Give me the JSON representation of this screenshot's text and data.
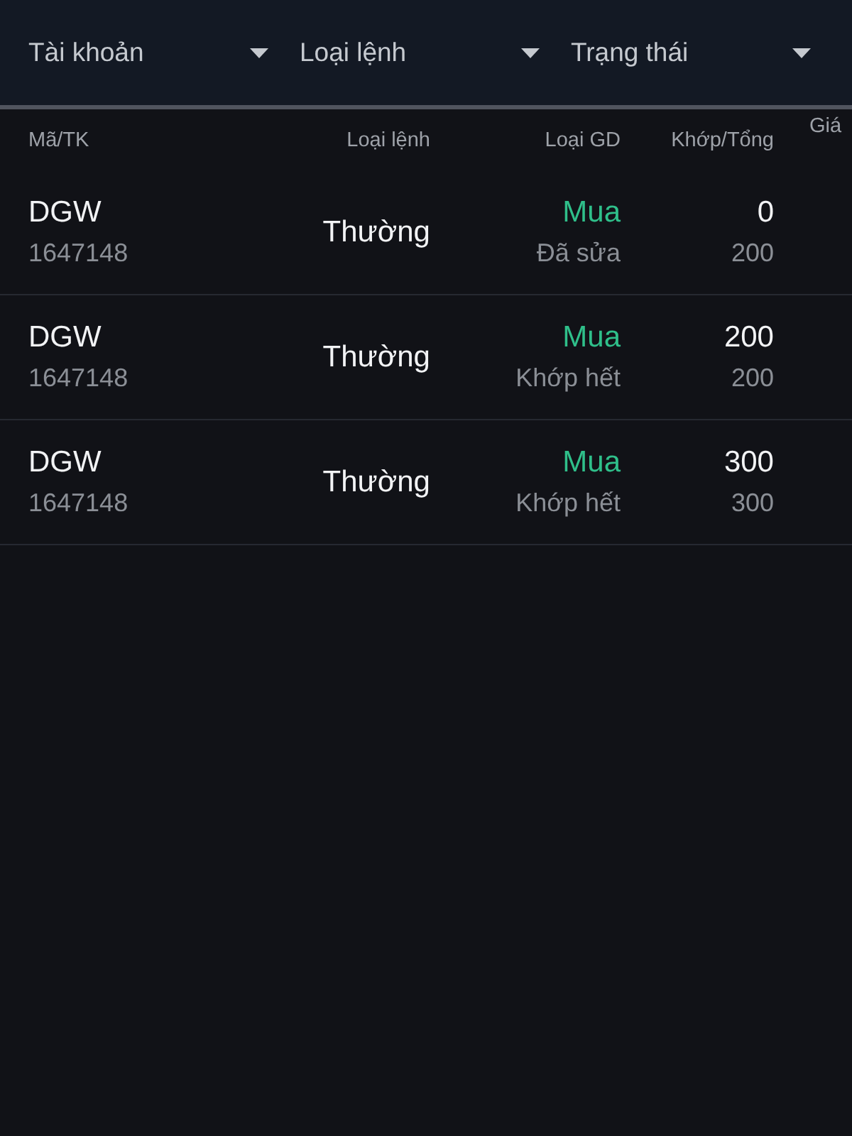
{
  "filters": [
    {
      "label": "Tài khoản"
    },
    {
      "label": "Loại lệnh"
    },
    {
      "label": "Trạng thái"
    }
  ],
  "table": {
    "columns": [
      "Mã/TK",
      "Loại lệnh",
      "Loại GD",
      "Khớp/Tổng",
      "Giá"
    ],
    "rows": [
      {
        "symbol": "DGW",
        "account": "1647148",
        "order_type": "Thường",
        "side": {
          "kind": "buy",
          "label": "Mua"
        },
        "status": "Đã sửa",
        "matched": "0",
        "total": "200"
      },
      {
        "symbol": "DGW",
        "account": "1647148",
        "order_type": "Thường",
        "side": {
          "kind": "buy",
          "label": "Mua"
        },
        "status": "Khớp hết",
        "matched": "200",
        "total": "200"
      },
      {
        "symbol": "DGW",
        "account": "1647148",
        "order_type": "Thường",
        "side": {
          "kind": "buy",
          "label": "Mua"
        },
        "status": "Khớp hết",
        "matched": "300",
        "total": "300"
      }
    ]
  }
}
